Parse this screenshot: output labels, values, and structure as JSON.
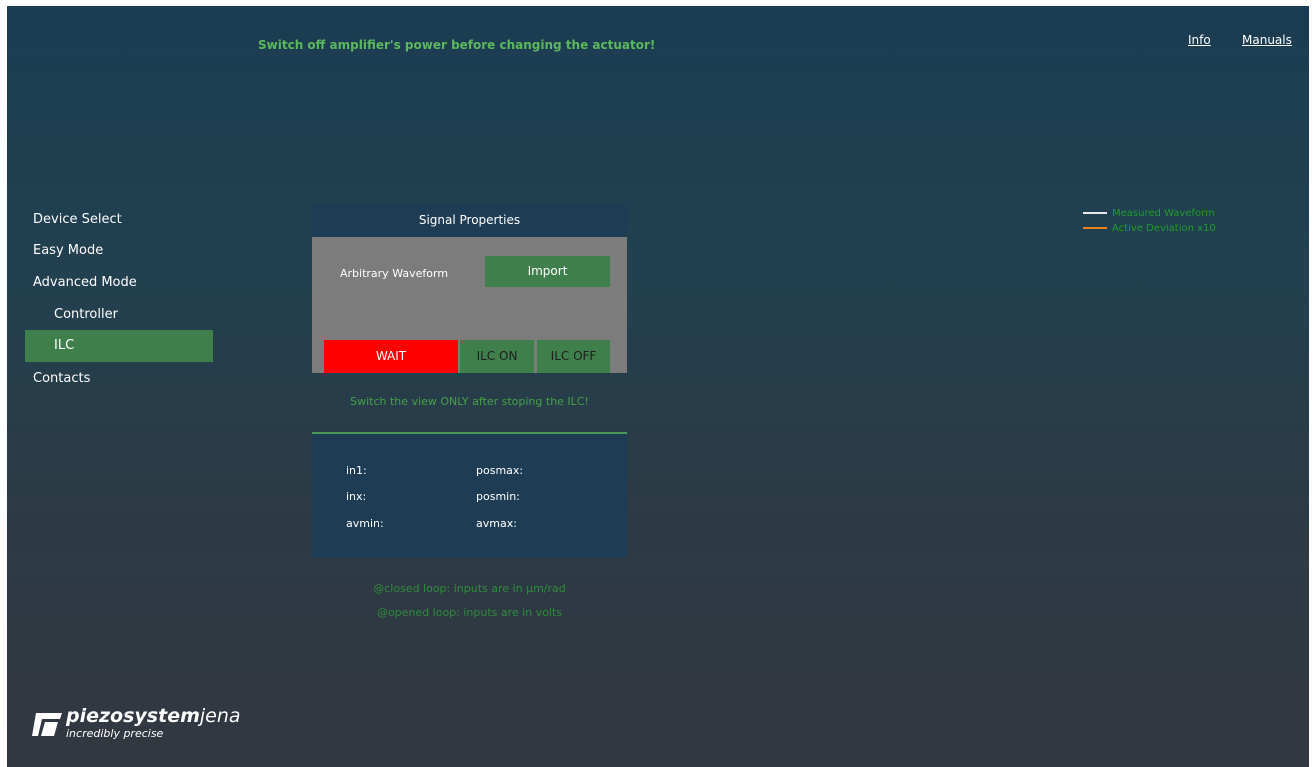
{
  "header": {
    "warning": "Switch off amplifier's power before changing the actuator!",
    "links": {
      "info": "Info",
      "manuals": "Manuals"
    }
  },
  "sidebar": {
    "items": [
      {
        "label": "Device Select",
        "active": false
      },
      {
        "label": "Easy Mode",
        "active": false
      },
      {
        "label": "Advanced Mode",
        "active": false
      },
      {
        "label": "Controller",
        "active": false
      },
      {
        "label": "ILC",
        "active": true
      },
      {
        "label": "Contacts",
        "active": false
      }
    ]
  },
  "signal_panel": {
    "title": "Signal Properties",
    "arbitrary_label": "Arbitrary Waveform",
    "import_label": "Import",
    "wait_label": "WAIT",
    "ilc_on_label": "ILC ON",
    "ilc_off_label": "ILC OFF"
  },
  "view_note": "Switch the view ONLY after stoping the ILC!",
  "readout": {
    "in1": "in1:",
    "inx": "inx:",
    "avmin": "avmin:",
    "posmax": "posmax:",
    "posmin": "posmin:",
    "avmax": "avmax:"
  },
  "loop_notes": {
    "closed": "@closed loop:  inputs are in µm/rad",
    "opened": "@opened loop:  inputs are in volts"
  },
  "legend": [
    {
      "label": "Measured Waveform",
      "color": "#e8e8e8"
    },
    {
      "label": "Active Deviation x10",
      "color": "#e8831e"
    }
  ],
  "logo": {
    "name_bold": "piezosystem",
    "name_light": "jena",
    "tagline": "incredibly precise"
  },
  "colors": {
    "accent_green": "#3f7f4c",
    "text_green": "#45a047",
    "wait_red": "#ff0000",
    "panel_header": "#1e3d55"
  }
}
